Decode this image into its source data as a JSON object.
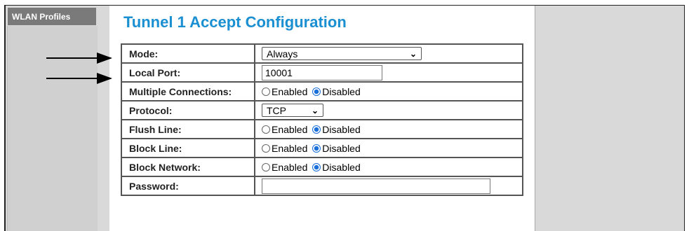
{
  "sidebar": {
    "active_item": "WLAN Profiles"
  },
  "page": {
    "title": "Tunnel 1 Accept Configuration"
  },
  "colors": {
    "title": "#1a8fd1",
    "radio_selected": "#1a6fd8",
    "nav_active_bg": "#7a7a7a"
  },
  "rows": {
    "mode": {
      "label": "Mode:",
      "value": "Always"
    },
    "local_port": {
      "label": "Local Port:",
      "value": "10001"
    },
    "multiple_connections": {
      "label": "Multiple Connections:",
      "enabled": "Enabled",
      "disabled": "Disabled",
      "selected": "Disabled"
    },
    "protocol": {
      "label": "Protocol:",
      "value": "TCP"
    },
    "flush_line": {
      "label": "Flush Line:",
      "enabled": "Enabled",
      "disabled": "Disabled",
      "selected": "Disabled"
    },
    "block_line": {
      "label": "Block Line:",
      "enabled": "Enabled",
      "disabled": "Disabled",
      "selected": "Disabled"
    },
    "block_network": {
      "label": "Block Network:",
      "enabled": "Enabled",
      "disabled": "Disabled",
      "selected": "Disabled"
    },
    "password": {
      "label": "Password:",
      "value": ""
    }
  },
  "icons": {
    "select_arrow": "chevron-down-icon",
    "annotation_arrow": "arrow-right-icon"
  }
}
